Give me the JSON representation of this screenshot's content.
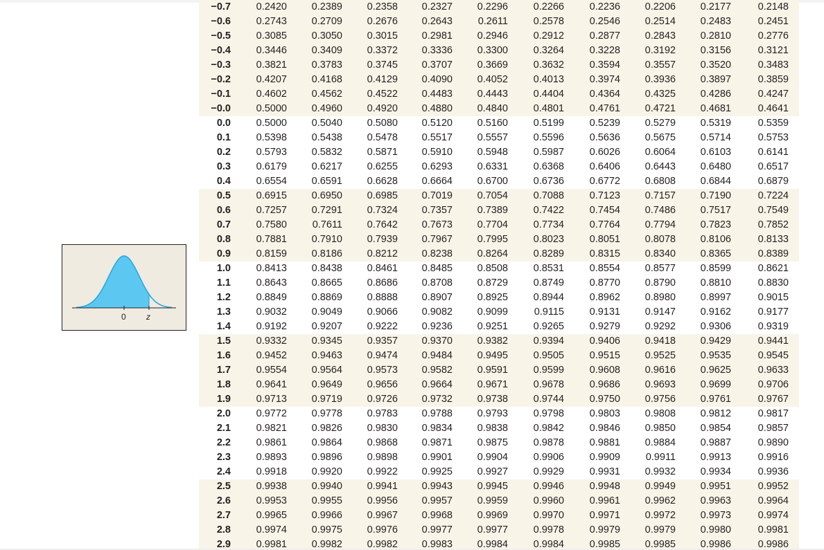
{
  "figure": {
    "label_zero": "0",
    "label_z": "z",
    "curve_color": "#29a8e0",
    "fill_color": "#5cc8f2",
    "background_color": "#efebe1"
  },
  "table": {
    "rows": [
      {
        "z": "−0.7",
        "p": [
          "0.2420",
          "0.2389",
          "0.2358",
          "0.2327",
          "0.2296",
          "0.2266",
          "0.2236",
          "0.2206",
          "0.2177",
          "0.2148"
        ]
      },
      {
        "z": "−0.6",
        "p": [
          "0.2743",
          "0.2709",
          "0.2676",
          "0.2643",
          "0.2611",
          "0.2578",
          "0.2546",
          "0.2514",
          "0.2483",
          "0.2451"
        ]
      },
      {
        "z": "−0.5",
        "p": [
          "0.3085",
          "0.3050",
          "0.3015",
          "0.2981",
          "0.2946",
          "0.2912",
          "0.2877",
          "0.2843",
          "0.2810",
          "0.2776"
        ]
      },
      {
        "z": "−0.4",
        "p": [
          "0.3446",
          "0.3409",
          "0.3372",
          "0.3336",
          "0.3300",
          "0.3264",
          "0.3228",
          "0.3192",
          "0.3156",
          "0.3121"
        ]
      },
      {
        "z": "−0.3",
        "p": [
          "0.3821",
          "0.3783",
          "0.3745",
          "0.3707",
          "0.3669",
          "0.3632",
          "0.3594",
          "0.3557",
          "0.3520",
          "0.3483"
        ]
      },
      {
        "z": "−0.2",
        "p": [
          "0.4207",
          "0.4168",
          "0.4129",
          "0.4090",
          "0.4052",
          "0.4013",
          "0.3974",
          "0.3936",
          "0.3897",
          "0.3859"
        ]
      },
      {
        "z": "−0.1",
        "p": [
          "0.4602",
          "0.4562",
          "0.4522",
          "0.4483",
          "0.4443",
          "0.4404",
          "0.4364",
          "0.4325",
          "0.4286",
          "0.4247"
        ]
      },
      {
        "z": "−0.0",
        "p": [
          "0.5000",
          "0.4960",
          "0.4920",
          "0.4880",
          "0.4840",
          "0.4801",
          "0.4761",
          "0.4721",
          "0.4681",
          "0.4641"
        ]
      },
      {
        "z": "0.0",
        "p": [
          "0.5000",
          "0.5040",
          "0.5080",
          "0.5120",
          "0.5160",
          "0.5199",
          "0.5239",
          "0.5279",
          "0.5319",
          "0.5359"
        ]
      },
      {
        "z": "0.1",
        "p": [
          "0.5398",
          "0.5438",
          "0.5478",
          "0.5517",
          "0.5557",
          "0.5596",
          "0.5636",
          "0.5675",
          "0.5714",
          "0.5753"
        ]
      },
      {
        "z": "0.2",
        "p": [
          "0.5793",
          "0.5832",
          "0.5871",
          "0.5910",
          "0.5948",
          "0.5987",
          "0.6026",
          "0.6064",
          "0.6103",
          "0.6141"
        ]
      },
      {
        "z": "0.3",
        "p": [
          "0.6179",
          "0.6217",
          "0.6255",
          "0.6293",
          "0.6331",
          "0.6368",
          "0.6406",
          "0.6443",
          "0.6480",
          "0.6517"
        ]
      },
      {
        "z": "0.4",
        "p": [
          "0.6554",
          "0.6591",
          "0.6628",
          "0.6664",
          "0.6700",
          "0.6736",
          "0.6772",
          "0.6808",
          "0.6844",
          "0.6879"
        ]
      },
      {
        "z": "0.5",
        "p": [
          "0.6915",
          "0.6950",
          "0.6985",
          "0.7019",
          "0.7054",
          "0.7088",
          "0.7123",
          "0.7157",
          "0.7190",
          "0.7224"
        ]
      },
      {
        "z": "0.6",
        "p": [
          "0.7257",
          "0.7291",
          "0.7324",
          "0.7357",
          "0.7389",
          "0.7422",
          "0.7454",
          "0.7486",
          "0.7517",
          "0.7549"
        ]
      },
      {
        "z": "0.7",
        "p": [
          "0.7580",
          "0.7611",
          "0.7642",
          "0.7673",
          "0.7704",
          "0.7734",
          "0.7764",
          "0.7794",
          "0.7823",
          "0.7852"
        ]
      },
      {
        "z": "0.8",
        "p": [
          "0.7881",
          "0.7910",
          "0.7939",
          "0.7967",
          "0.7995",
          "0.8023",
          "0.8051",
          "0.8078",
          "0.8106",
          "0.8133"
        ]
      },
      {
        "z": "0.9",
        "p": [
          "0.8159",
          "0.8186",
          "0.8212",
          "0.8238",
          "0.8264",
          "0.8289",
          "0.8315",
          "0.8340",
          "0.8365",
          "0.8389"
        ]
      },
      {
        "z": "1.0",
        "p": [
          "0.8413",
          "0.8438",
          "0.8461",
          "0.8485",
          "0.8508",
          "0.8531",
          "0.8554",
          "0.8577",
          "0.8599",
          "0.8621"
        ]
      },
      {
        "z": "1.1",
        "p": [
          "0.8643",
          "0.8665",
          "0.8686",
          "0.8708",
          "0.8729",
          "0.8749",
          "0.8770",
          "0.8790",
          "0.8810",
          "0.8830"
        ]
      },
      {
        "z": "1.2",
        "p": [
          "0.8849",
          "0.8869",
          "0.8888",
          "0.8907",
          "0.8925",
          "0.8944",
          "0.8962",
          "0.8980",
          "0.8997",
          "0.9015"
        ]
      },
      {
        "z": "1.3",
        "p": [
          "0.9032",
          "0.9049",
          "0.9066",
          "0.9082",
          "0.9099",
          "0.9115",
          "0.9131",
          "0.9147",
          "0.9162",
          "0.9177"
        ]
      },
      {
        "z": "1.4",
        "p": [
          "0.9192",
          "0.9207",
          "0.9222",
          "0.9236",
          "0.9251",
          "0.9265",
          "0.9279",
          "0.9292",
          "0.9306",
          "0.9319"
        ]
      },
      {
        "z": "1.5",
        "p": [
          "0.9332",
          "0.9345",
          "0.9357",
          "0.9370",
          "0.9382",
          "0.9394",
          "0.9406",
          "0.9418",
          "0.9429",
          "0.9441"
        ]
      },
      {
        "z": "1.6",
        "p": [
          "0.9452",
          "0.9463",
          "0.9474",
          "0.9484",
          "0.9495",
          "0.9505",
          "0.9515",
          "0.9525",
          "0.9535",
          "0.9545"
        ]
      },
      {
        "z": "1.7",
        "p": [
          "0.9554",
          "0.9564",
          "0.9573",
          "0.9582",
          "0.9591",
          "0.9599",
          "0.9608",
          "0.9616",
          "0.9625",
          "0.9633"
        ]
      },
      {
        "z": "1.8",
        "p": [
          "0.9641",
          "0.9649",
          "0.9656",
          "0.9664",
          "0.9671",
          "0.9678",
          "0.9686",
          "0.9693",
          "0.9699",
          "0.9706"
        ]
      },
      {
        "z": "1.9",
        "p": [
          "0.9713",
          "0.9719",
          "0.9726",
          "0.9732",
          "0.9738",
          "0.9744",
          "0.9750",
          "0.9756",
          "0.9761",
          "0.9767"
        ]
      },
      {
        "z": "2.0",
        "p": [
          "0.9772",
          "0.9778",
          "0.9783",
          "0.9788",
          "0.9793",
          "0.9798",
          "0.9803",
          "0.9808",
          "0.9812",
          "0.9817"
        ]
      },
      {
        "z": "2.1",
        "p": [
          "0.9821",
          "0.9826",
          "0.9830",
          "0.9834",
          "0.9838",
          "0.9842",
          "0.9846",
          "0.9850",
          "0.9854",
          "0.9857"
        ]
      },
      {
        "z": "2.2",
        "p": [
          "0.9861",
          "0.9864",
          "0.9868",
          "0.9871",
          "0.9875",
          "0.9878",
          "0.9881",
          "0.9884",
          "0.9887",
          "0.9890"
        ]
      },
      {
        "z": "2.3",
        "p": [
          "0.9893",
          "0.9896",
          "0.9898",
          "0.9901",
          "0.9904",
          "0.9906",
          "0.9909",
          "0.9911",
          "0.9913",
          "0.9916"
        ]
      },
      {
        "z": "2.4",
        "p": [
          "0.9918",
          "0.9920",
          "0.9922",
          "0.9925",
          "0.9927",
          "0.9929",
          "0.9931",
          "0.9932",
          "0.9934",
          "0.9936"
        ]
      },
      {
        "z": "2.5",
        "p": [
          "0.9938",
          "0.9940",
          "0.9941",
          "0.9943",
          "0.9945",
          "0.9946",
          "0.9948",
          "0.9949",
          "0.9951",
          "0.9952"
        ]
      },
      {
        "z": "2.6",
        "p": [
          "0.9953",
          "0.9955",
          "0.9956",
          "0.9957",
          "0.9959",
          "0.9960",
          "0.9961",
          "0.9962",
          "0.9963",
          "0.9964"
        ]
      },
      {
        "z": "2.7",
        "p": [
          "0.9965",
          "0.9966",
          "0.9967",
          "0.9968",
          "0.9969",
          "0.9970",
          "0.9971",
          "0.9972",
          "0.9973",
          "0.9974"
        ]
      },
      {
        "z": "2.8",
        "p": [
          "0.9974",
          "0.9975",
          "0.9976",
          "0.9977",
          "0.9977",
          "0.9978",
          "0.9979",
          "0.9979",
          "0.9980",
          "0.9981"
        ]
      },
      {
        "z": "2.9",
        "p": [
          "0.9981",
          "0.9982",
          "0.9982",
          "0.9983",
          "0.9984",
          "0.9984",
          "0.9985",
          "0.9985",
          "0.9986",
          "0.9986"
        ]
      }
    ]
  }
}
